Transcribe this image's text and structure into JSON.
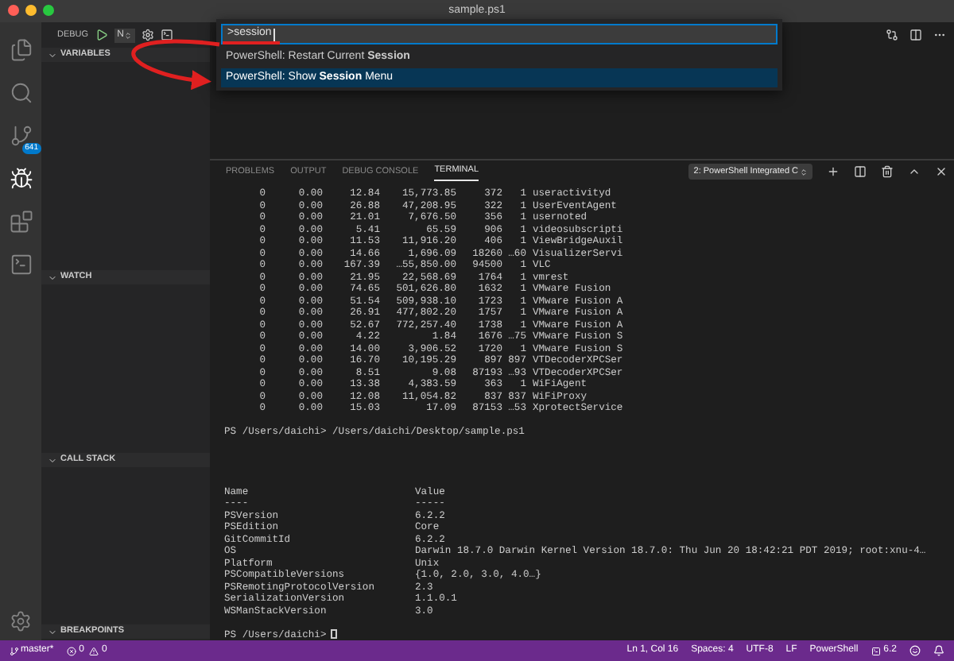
{
  "window": {
    "title": "sample.ps1"
  },
  "activity_bar": {
    "items": [
      {
        "kind": "files",
        "selected": false
      },
      {
        "kind": "search",
        "selected": false
      },
      {
        "kind": "source-control",
        "selected": false,
        "badge": "641"
      },
      {
        "kind": "debug",
        "selected": true
      },
      {
        "kind": "extensions",
        "selected": false
      },
      {
        "kind": "powershell",
        "selected": false
      }
    ]
  },
  "debug_toolbar": {
    "label": "DEBUG",
    "configuration": "N"
  },
  "sidebar": {
    "sections": [
      {
        "title": "VARIABLES",
        "expanded": true
      },
      {
        "title": "WATCH",
        "expanded": true
      },
      {
        "title": "CALL STACK",
        "expanded": true
      },
      {
        "title": "BREAKPOINTS",
        "expanded": true
      }
    ]
  },
  "command_palette": {
    "value": ">session",
    "items": [
      {
        "label": "PowerShell: Restart Current **Session**",
        "selected": false
      },
      {
        "label": "PowerShell: Show **Session** Menu",
        "selected": true
      }
    ]
  },
  "panel": {
    "tabs": [
      {
        "label": "PROBLEMS",
        "selected": false
      },
      {
        "label": "OUTPUT",
        "selected": false
      },
      {
        "label": "DEBUG CONSOLE",
        "selected": false
      },
      {
        "label": "TERMINAL",
        "selected": true
      }
    ],
    "terminal_selector": "2: PowerShell Integrated C",
    "terminal": {
      "process_rows": [
        [
          "0",
          "0.00",
          "12.84",
          "15,773.85",
          "372",
          "1",
          "useractivityd"
        ],
        [
          "0",
          "0.00",
          "26.88",
          "47,208.95",
          "322",
          "1",
          "UserEventAgent"
        ],
        [
          "0",
          "0.00",
          "21.01",
          "7,676.50",
          "356",
          "1",
          "usernoted"
        ],
        [
          "0",
          "0.00",
          "5.41",
          "65.59",
          "906",
          "1",
          "videosubscripti"
        ],
        [
          "0",
          "0.00",
          "11.53",
          "11,916.20",
          "406",
          "1",
          "ViewBridgeAuxil"
        ],
        [
          "0",
          "0.00",
          "14.66",
          "1,696.09",
          "18260",
          "…60",
          "VisualizerServi"
        ],
        [
          "0",
          "0.00",
          "167.39",
          "…55,850.00",
          "94500",
          "1",
          "VLC"
        ],
        [
          "0",
          "0.00",
          "21.95",
          "22,568.69",
          "1764",
          "1",
          "vmrest"
        ],
        [
          "0",
          "0.00",
          "74.65",
          "501,626.80",
          "1632",
          "1",
          "VMware Fusion"
        ],
        [
          "0",
          "0.00",
          "51.54",
          "509,938.10",
          "1723",
          "1",
          "VMware Fusion A"
        ],
        [
          "0",
          "0.00",
          "26.91",
          "477,802.20",
          "1757",
          "1",
          "VMware Fusion A"
        ],
        [
          "0",
          "0.00",
          "52.67",
          "772,257.40",
          "1738",
          "1",
          "VMware Fusion A"
        ],
        [
          "0",
          "0.00",
          "4.22",
          "1.84",
          "1676",
          "…75",
          "VMware Fusion S"
        ],
        [
          "0",
          "0.00",
          "14.00",
          "3,906.52",
          "1720",
          "1",
          "VMware Fusion S"
        ],
        [
          "0",
          "0.00",
          "16.70",
          "10,195.29",
          "897",
          "897",
          "VTDecoderXPCSer"
        ],
        [
          "0",
          "0.00",
          "8.51",
          "9.08",
          "87193",
          "…93",
          "VTDecoderXPCSer"
        ],
        [
          "0",
          "0.00",
          "13.38",
          "4,383.59",
          "363",
          "1",
          "WiFiAgent"
        ],
        [
          "0",
          "0.00",
          "12.08",
          "11,054.82",
          "837",
          "837",
          "WiFiProxy"
        ],
        [
          "0",
          "0.00",
          "15.03",
          "17.09",
          "87153",
          "…53",
          "XprotectService"
        ]
      ],
      "prompt_1": "PS /Users/daichi> /Users/daichi/Desktop/sample.ps1",
      "table": {
        "columns": [
          "Name",
          "Value"
        ],
        "separators": [
          "----",
          "-----"
        ],
        "rows": [
          [
            "PSVersion",
            "6.2.2"
          ],
          [
            "PSEdition",
            "Core"
          ],
          [
            "GitCommitId",
            "6.2.2"
          ],
          [
            "OS",
            "Darwin 18.7.0 Darwin Kernel Version 18.7.0: Thu Jun 20 18:42:21 PDT 2019; root:xnu-4…"
          ],
          [
            "Platform",
            "Unix"
          ],
          [
            "PSCompatibleVersions",
            "{1.0, 2.0, 3.0, 4.0…}"
          ],
          [
            "PSRemotingProtocolVersion",
            "2.3"
          ],
          [
            "SerializationVersion",
            "1.1.0.1"
          ],
          [
            "WSManStackVersion",
            "3.0"
          ]
        ]
      },
      "prompt_2": "PS /Users/daichi>"
    }
  },
  "status_bar": {
    "branch": "master*",
    "errors": "0",
    "warnings": "0",
    "items": [
      "Ln 1, Col 16",
      "Spaces: 4",
      "UTF-8",
      "LF",
      "PowerShell"
    ],
    "version": "6.2"
  }
}
